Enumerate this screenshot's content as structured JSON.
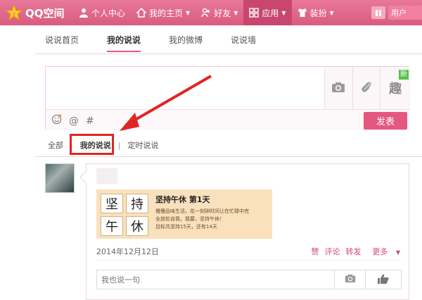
{
  "app": {
    "logo_text": "QQ空间"
  },
  "nav": {
    "items": [
      {
        "label": "个人中心"
      },
      {
        "label": "我的主页"
      },
      {
        "label": "好友"
      },
      {
        "label": "应用"
      },
      {
        "label": "装扮"
      }
    ],
    "user_label": "用户"
  },
  "tabs": [
    {
      "label": "说说首页"
    },
    {
      "label": "我的说说"
    },
    {
      "label": "我的微博"
    },
    {
      "label": "说说墙"
    }
  ],
  "compose": {
    "new_badge": "新",
    "publish_label": "发表",
    "fun_label": "趣"
  },
  "filters": [
    {
      "label": "全部"
    },
    {
      "label": "我的说说"
    },
    {
      "label": "定时说说"
    }
  ],
  "post": {
    "share": {
      "chars": [
        "坚",
        "持",
        "午",
        "休"
      ],
      "title": "坚持午休   第1天",
      "desc1": "慢慢品味生活，花一刻钟时间让在忙碌中完",
      "desc2": "全放松自我，我要，坚持午休！",
      "desc3": "目标共坚持15天，还有14天"
    },
    "date": "2014年12月12日",
    "actions": {
      "like": "赞",
      "comment": "评论",
      "forward": "转发",
      "more": "更多"
    },
    "reply_placeholder": "我也说一句"
  },
  "colors": {
    "brand": "#e4587f",
    "highlight": "#e02525"
  }
}
